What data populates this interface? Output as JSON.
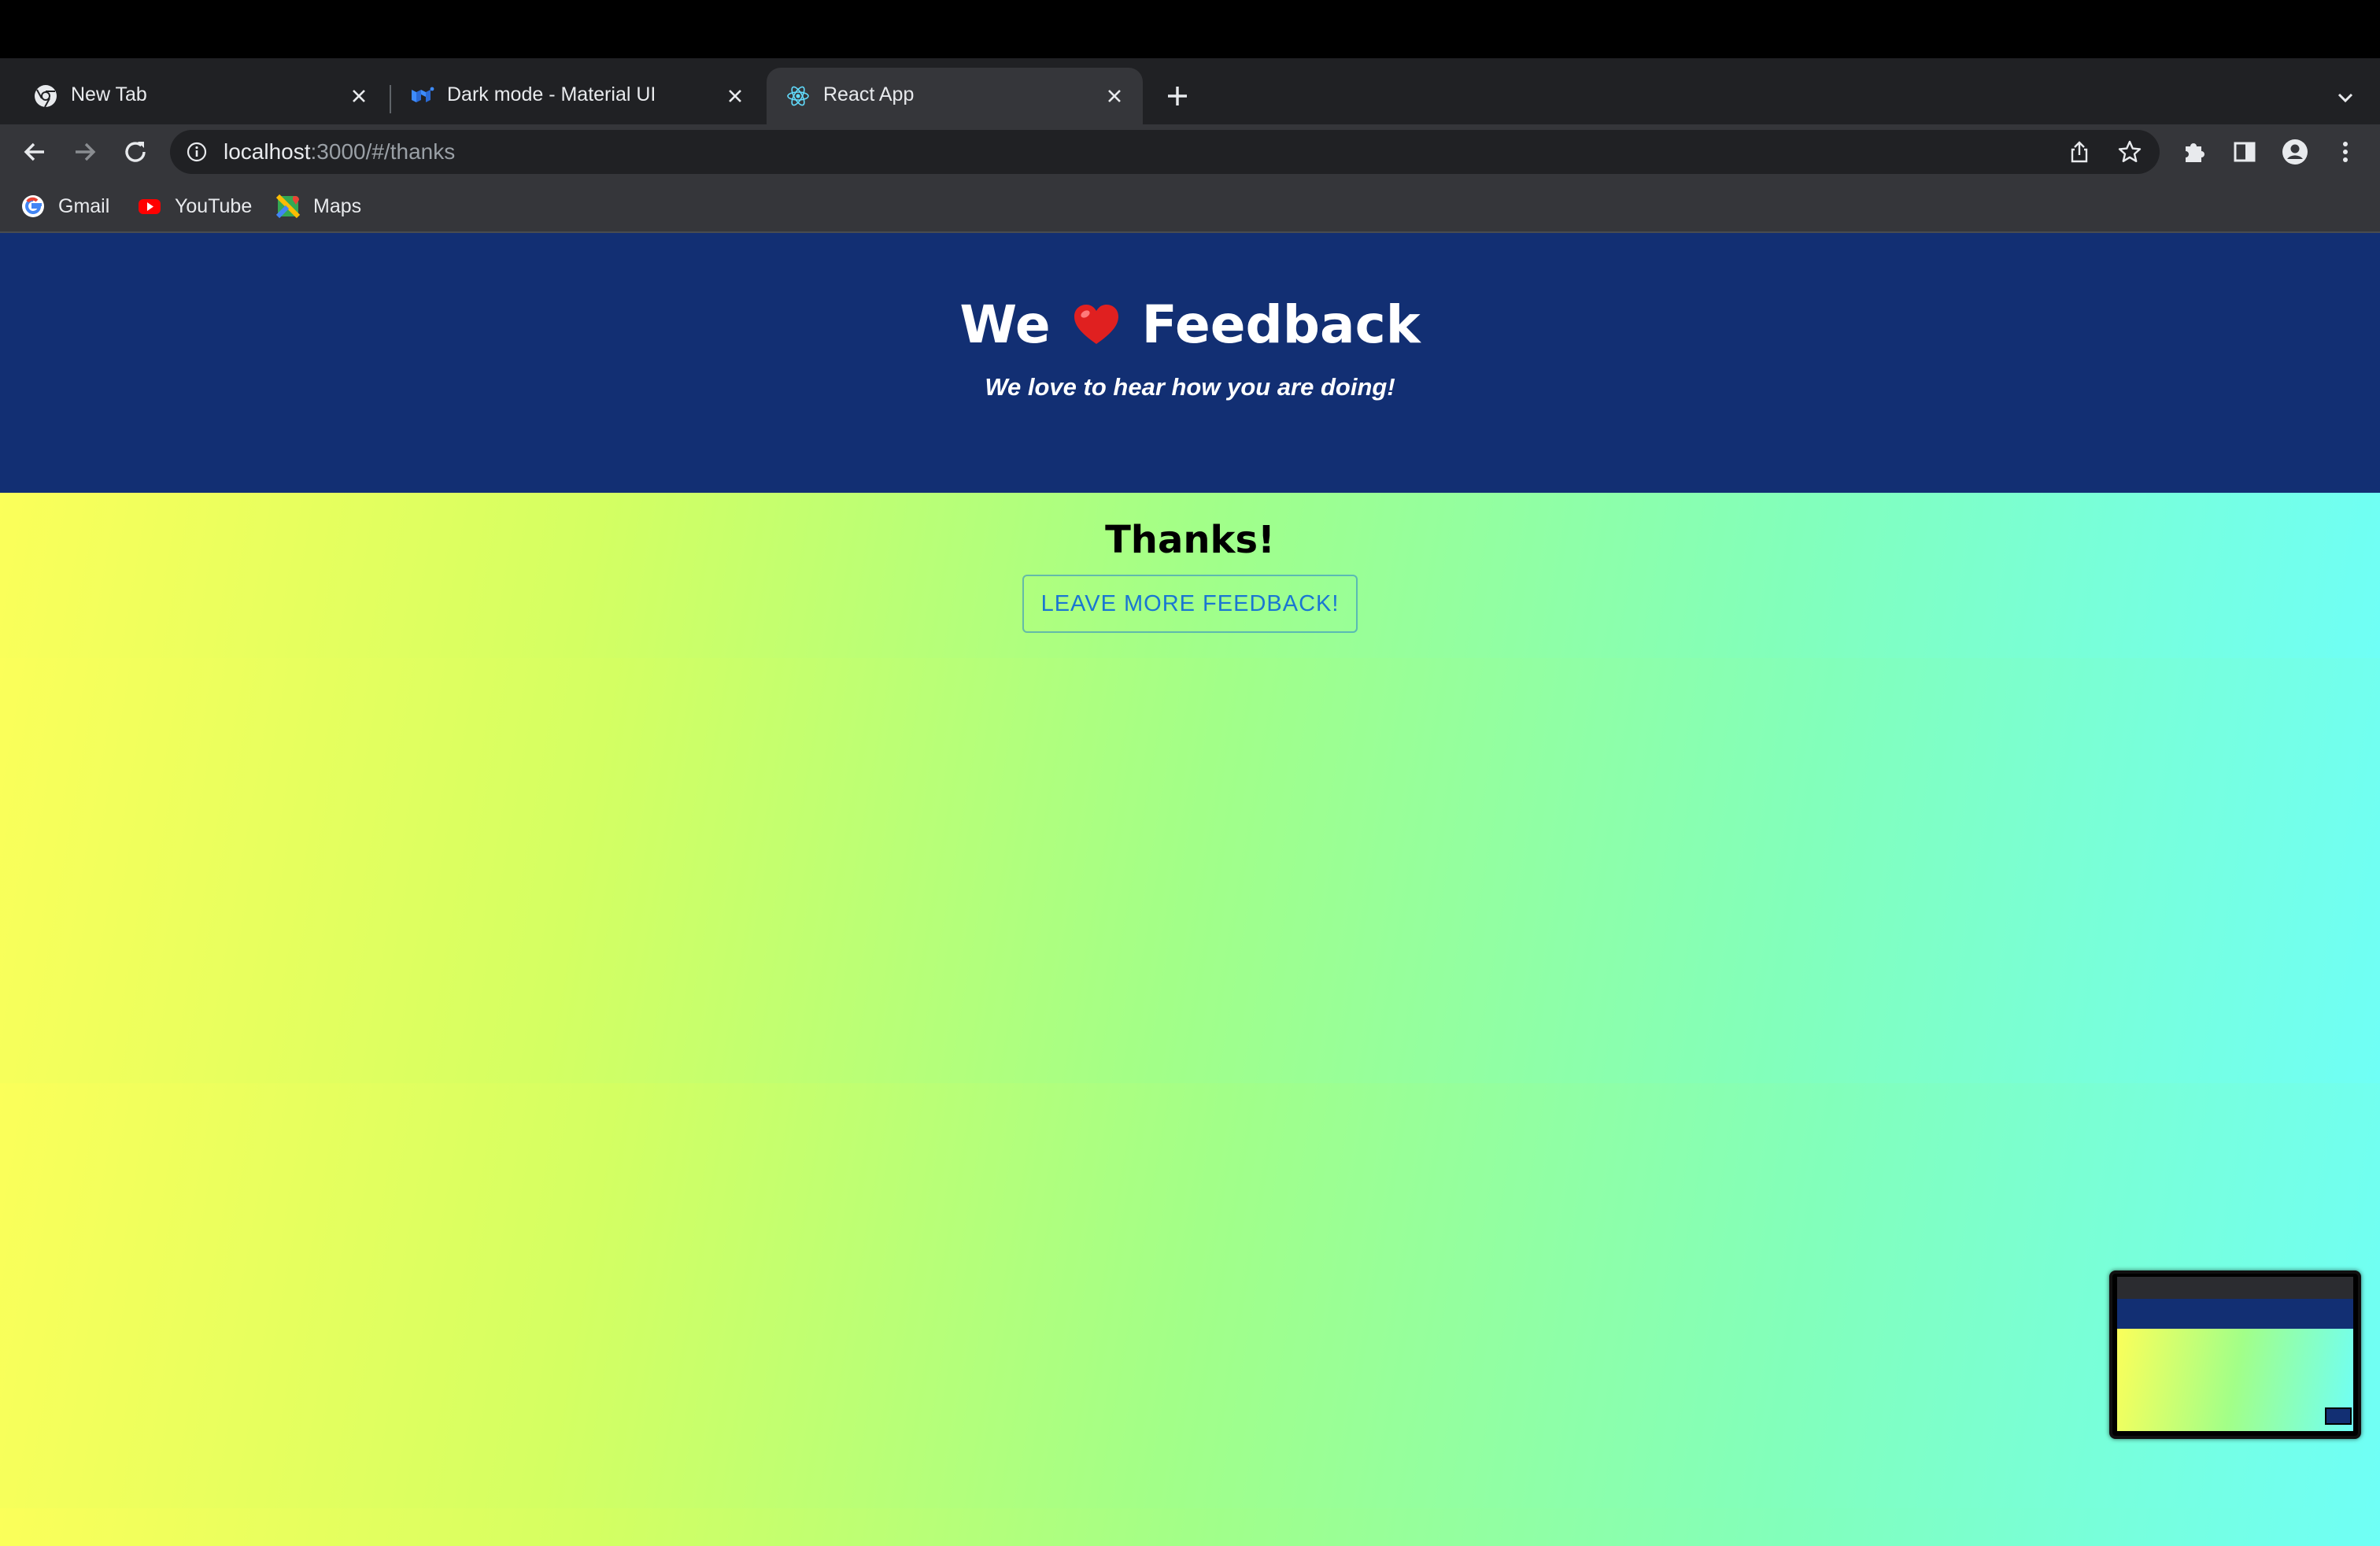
{
  "browser": {
    "tabs": [
      {
        "title": "New Tab",
        "icon": "chrome-icon",
        "active": false
      },
      {
        "title": "Dark mode - Material UI",
        "icon": "mui-logo-icon",
        "active": false
      },
      {
        "title": "React App",
        "icon": "react-logo-icon",
        "active": true
      }
    ],
    "url": {
      "host": "localhost",
      "path": ":3000/#/thanks"
    },
    "bookmarks": [
      {
        "label": "Gmail",
        "icon": "google-icon"
      },
      {
        "label": "YouTube",
        "icon": "youtube-icon"
      },
      {
        "label": "Maps",
        "icon": "maps-icon"
      }
    ]
  },
  "header": {
    "title_left": "We",
    "title_icon": "heart-icon",
    "title_right": "Feedback",
    "subtitle": "We love to hear how you are doing!"
  },
  "main": {
    "heading": "Thanks!",
    "button_label": "LEAVE MORE FEEDBACK!"
  },
  "colors": {
    "header_bg": "#122f73",
    "gradient_start": "#fbff5a",
    "gradient_end": "#6ffff6",
    "button_text": "#1976d2",
    "heart": "#e02020"
  }
}
